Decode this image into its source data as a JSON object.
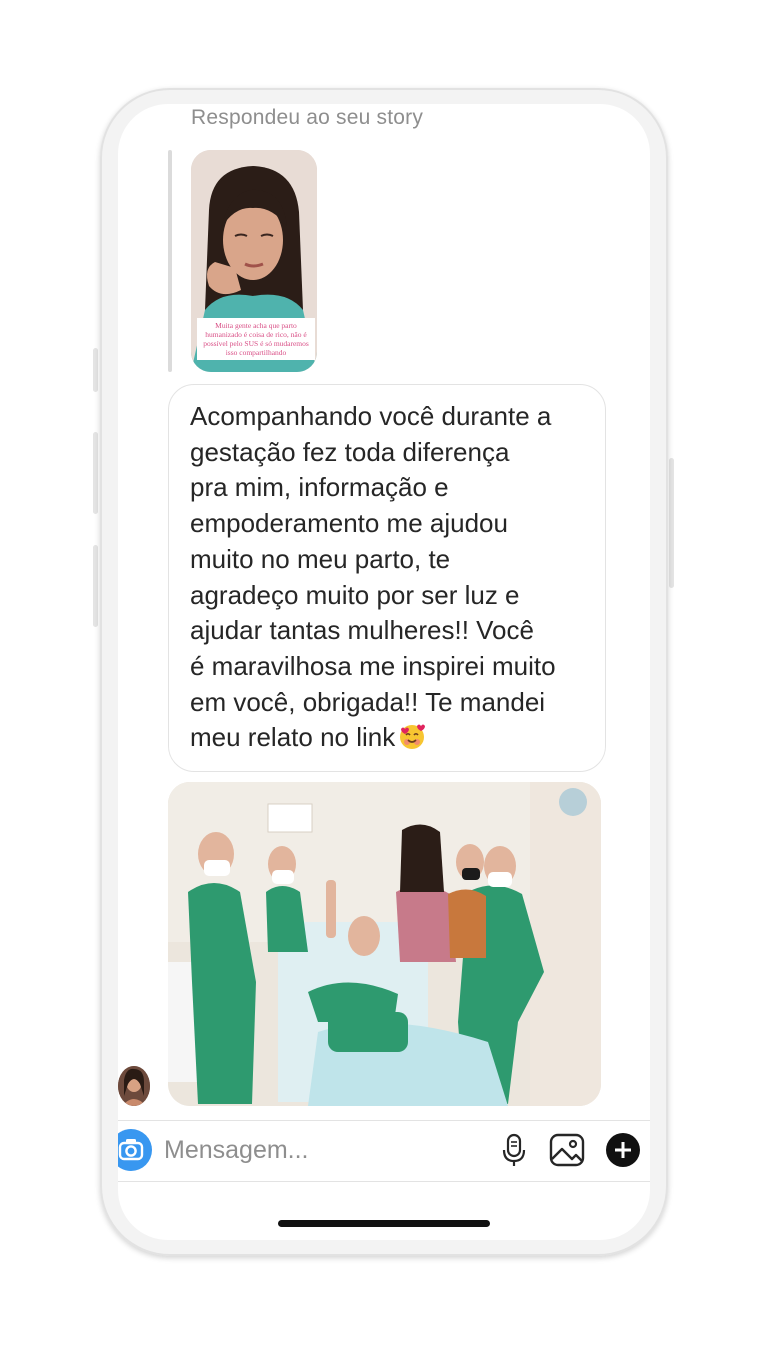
{
  "conversation": {
    "story_reply_caption": "Respondeu ao seu story",
    "story_thumbnail": {
      "overlay_text": "Muita gente acha que parto humanizado é coisa de rico, não é possível pelo SUS é só mudaremos isso compartilhando"
    },
    "message": {
      "text": "Acompanhando você durante a\ngestação fez toda diferença\npra mim, informação e\nempoderamento me ajudou\nmuito no meu parto, te\nagradeço muito por ser luz e\najudar tantas mulheres!! Você\né maravilhosa me inspirei muito\nem você, obrigada!! Te mandei\nmeu relato no link",
      "emoji": "smiling-face-with-hearts"
    },
    "attached_photo": "hospital-room-group-photo",
    "sender_avatar": "avatar"
  },
  "composer": {
    "placeholder": "Mensagem...",
    "value": "",
    "icons": [
      "camera-icon",
      "microphone-icon",
      "gallery-icon",
      "plus-icon"
    ]
  },
  "colors": {
    "accent": "#3897f0",
    "text": "#262626",
    "muted": "#8e8e8e",
    "border": "#e3e3e3"
  }
}
